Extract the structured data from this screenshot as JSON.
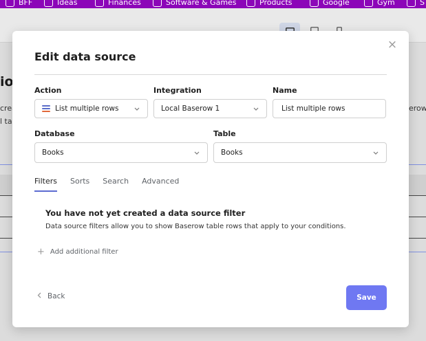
{
  "bookmarks": [
    "BFF",
    "Ideas",
    "Finances",
    "Software & Games",
    "Products",
    "Google",
    "Gym",
    "S"
  ],
  "preview": {
    "device_icons": [
      "desktop-icon",
      "tablet-icon",
      "mobile-icon"
    ],
    "heading_fragment": "io",
    "text_fragment_1": "crea",
    "text_fragment_2": "l tak",
    "text_fragment_right": "erow"
  },
  "modal": {
    "title": "Edit data source",
    "close_icon": "×",
    "action_label": "Action",
    "action_value": "List multiple rows",
    "integration_label": "Integration",
    "integration_value": "Local Baserow 1",
    "name_label": "Name",
    "name_value": "List multiple rows",
    "database_label": "Database",
    "database_value": "Books",
    "table_label": "Table",
    "table_value": "Books",
    "tabs": [
      "Filters",
      "Sorts",
      "Search",
      "Advanced"
    ],
    "active_tab": "Filters",
    "empty_title": "You have not yet created a data source filter",
    "empty_desc": "Data source filters allow you to show Baserow table rows that apply to your conditions.",
    "add_filter_label": "Add additional filter",
    "back_label": "Back",
    "save_label": "Save"
  },
  "colors": {
    "accent": "#6f78f2",
    "tab_underline": "#5c6bd1",
    "bookmark_bar": "#8c06b8",
    "rows_icon": "#5a6cc9"
  }
}
